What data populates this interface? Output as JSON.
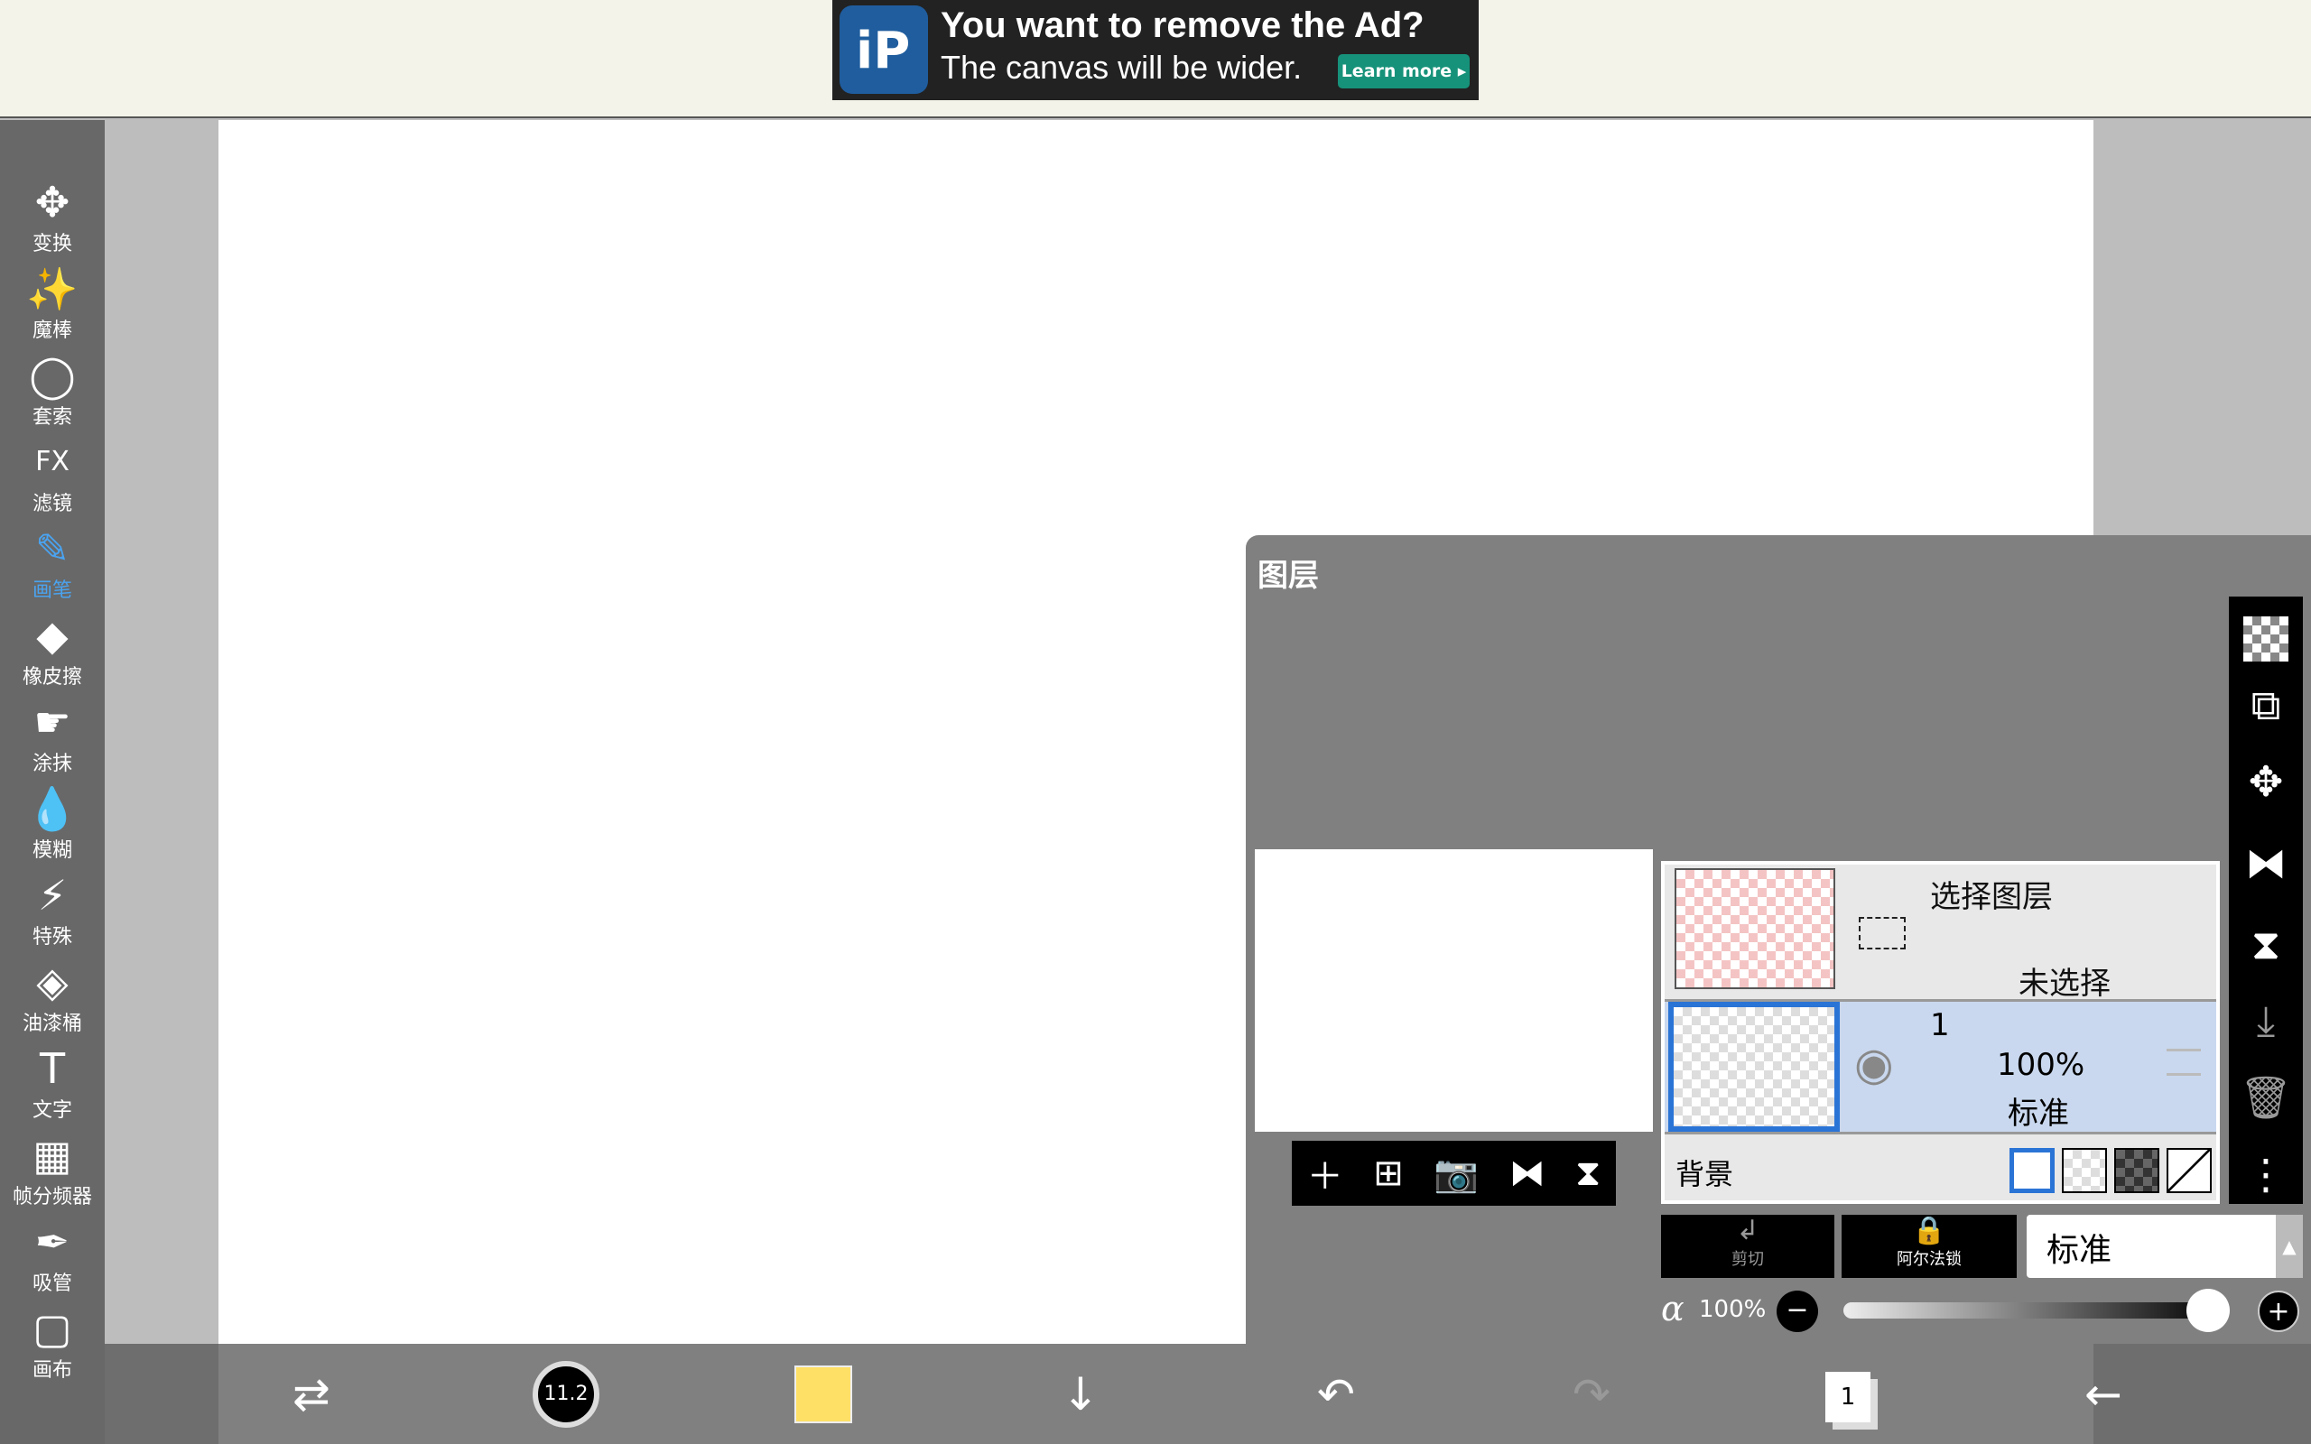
{
  "ad": {
    "title": "You want to remove the Ad?",
    "subtitle": "The canvas will be wider.",
    "button": "Learn more ▸",
    "logo": "iP"
  },
  "tools": [
    {
      "label": "变换",
      "icon": "✥"
    },
    {
      "label": "魔棒",
      "icon": "✨"
    },
    {
      "label": "套索",
      "icon": "◯"
    },
    {
      "label": "滤镜",
      "icon": "FX"
    },
    {
      "label": "画笔",
      "icon": "✎",
      "active": true
    },
    {
      "label": "橡皮擦",
      "icon": "◆"
    },
    {
      "label": "涂抹",
      "icon": "☛"
    },
    {
      "label": "模糊",
      "icon": "💧"
    },
    {
      "label": "特殊",
      "icon": "⚡"
    },
    {
      "label": "油漆桶",
      "icon": "◈"
    },
    {
      "label": "文字",
      "icon": "T"
    },
    {
      "label": "帧分频器",
      "icon": "▦"
    },
    {
      "label": "吸管",
      "icon": "✒"
    },
    {
      "label": "画布",
      "icon": "▢"
    }
  ],
  "bottom": {
    "brush_size": "11.2",
    "color": "#ffe066",
    "layer_count": "1"
  },
  "layers": {
    "title": "图层",
    "selection_layer": {
      "title": "选择图层",
      "status": "未选择"
    },
    "layer1": {
      "name": "1",
      "opacity": "100%",
      "blend": "标准"
    },
    "background_label": "背景",
    "clip_label": "剪切",
    "alpha_lock_label": "阿尔法锁",
    "blend_mode": "标准",
    "alpha_label": "α",
    "alpha_value": "100%",
    "alpha_fraction": 1.0
  }
}
